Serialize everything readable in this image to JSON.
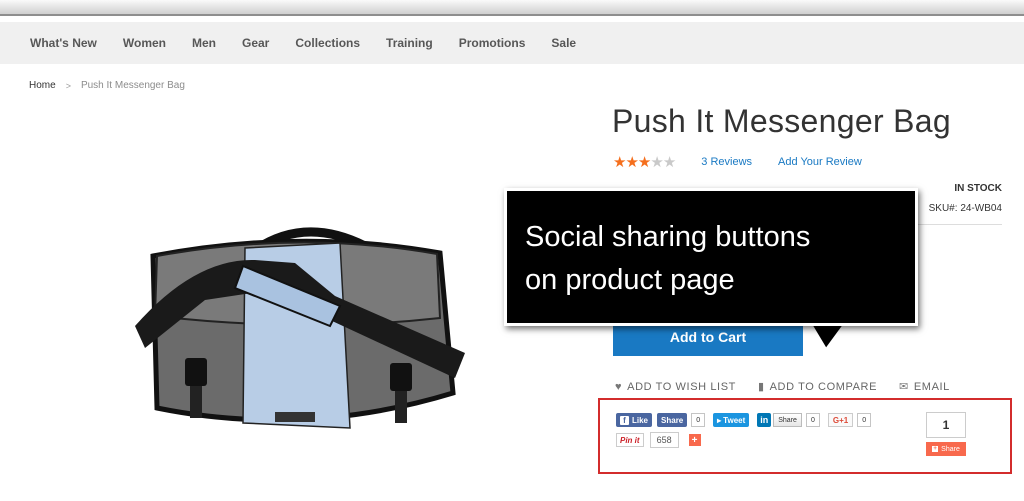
{
  "nav": {
    "items": [
      "What's New",
      "Women",
      "Men",
      "Gear",
      "Collections",
      "Training",
      "Promotions",
      "Sale"
    ]
  },
  "breadcrumb": {
    "home": "Home",
    "separator": ">",
    "current": "Push It Messenger Bag"
  },
  "product": {
    "title": "Push It Messenger Bag",
    "rating_value": 3.5,
    "rating_max": 5,
    "reviews_label": "3 Reviews",
    "add_review_label": "Add Your Review",
    "stock_status": "IN STOCK",
    "sku_label": "SKU#:",
    "sku_value": "24-WB04",
    "add_to_cart_label": "Add to Cart"
  },
  "actions": {
    "wishlist": "ADD TO WISH LIST",
    "compare": "ADD TO COMPARE",
    "email": "EMAIL"
  },
  "social": {
    "fb_like": "Like",
    "fb_share": "Share",
    "fb_count": "0",
    "tweet": "Tweet",
    "linkedin_logo": "in",
    "linkedin_share": "Share",
    "linkedin_count": "0",
    "gplus": "G+1",
    "gplus_count": "0",
    "pinit": "Pin it",
    "pin_count": "658",
    "plus_symbol": "+",
    "share_total": "1",
    "share_label": "Share"
  },
  "callout": {
    "line1": "Social sharing buttons",
    "line2": "on product page"
  },
  "colors": {
    "accent": "#1979c3",
    "star": "#f56f1d",
    "highlight_border": "#d32c2c",
    "callout_bg": "#000000"
  }
}
